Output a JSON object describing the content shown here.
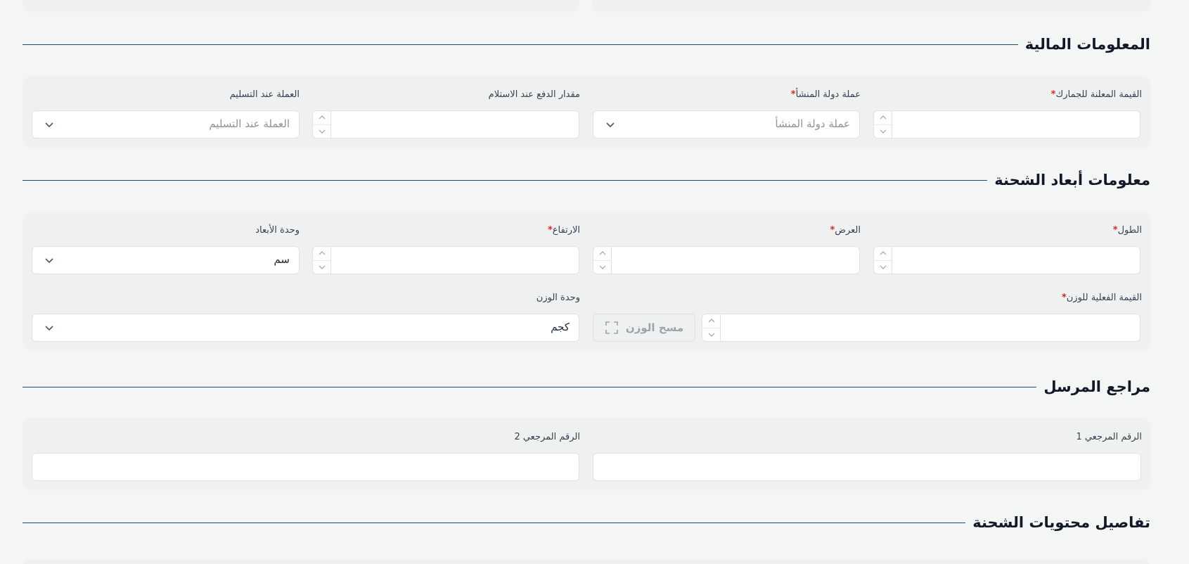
{
  "financial": {
    "title": "المعلومات المالية",
    "declared_value": {
      "label": "القيمة المعلنة للجمارك",
      "required": "*",
      "value": ""
    },
    "origin_currency": {
      "label": "عملة دولة المنشأ",
      "required": "*",
      "placeholder": "عملة دولة المنشأ"
    },
    "cod_amount": {
      "label": "مقدار الدفع عند الاستلام",
      "value": ""
    },
    "cod_currency": {
      "label": "العملة عند التسليم",
      "placeholder": "العملة عند التسليم"
    }
  },
  "dimensions": {
    "title": "معلومات أبعاد الشحنة",
    "length": {
      "label": "الطول",
      "required": "*"
    },
    "width": {
      "label": "العرض",
      "required": "*"
    },
    "height": {
      "label": "الارتفاع",
      "required": "*"
    },
    "unit": {
      "label": "وحدة الأبعاد",
      "value": "سم"
    },
    "actual_weight": {
      "label": "القيمة الفعلية للوزن",
      "required": "*"
    },
    "scan_weight_button": "مسح الوزن",
    "weight_unit": {
      "label": "وحدة الوزن",
      "value": "كجم"
    }
  },
  "sender_refs": {
    "title": "مراجع المرسل",
    "ref1": {
      "label": "الرقم المرجعي 1"
    },
    "ref2": {
      "label": "الرقم المرجعي 2"
    }
  },
  "contents": {
    "title": "تفاصيل محتويات الشحنة"
  },
  "icons": [
    "chevron-up-icon",
    "chevron-down-icon",
    "scan-icon"
  ]
}
